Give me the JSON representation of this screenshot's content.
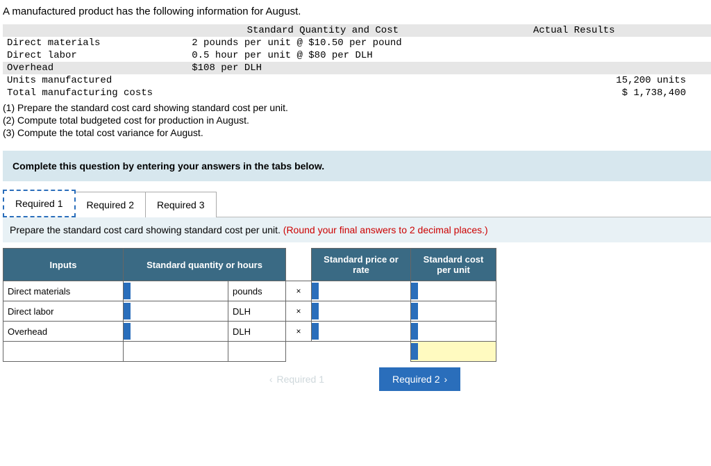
{
  "question": {
    "intro": "A manufactured product has the following information for August.",
    "table": {
      "headers": {
        "std": "Standard Quantity and Cost",
        "actual": "Actual Results"
      },
      "rows": [
        {
          "label": "Direct materials",
          "std": "2 pounds per unit @ $10.50 per pound",
          "actual": ""
        },
        {
          "label": "Direct labor",
          "std": "0.5 hour per unit @ $80 per DLH",
          "actual": ""
        },
        {
          "label": "Overhead",
          "std": "$108 per DLH",
          "actual": ""
        },
        {
          "label": "Units manufactured",
          "std": "",
          "actual": "15,200 units"
        },
        {
          "label": "Total manufacturing costs",
          "std": "",
          "actual": "$ 1,738,400"
        }
      ]
    },
    "parts": [
      "(1) Prepare the standard cost card showing standard cost per unit.",
      "(2) Compute total budgeted cost for production in August.",
      "(3) Compute the total cost variance for August."
    ]
  },
  "banner": "Complete this question by entering your answers in the tabs below.",
  "tabs": {
    "t1": "Required 1",
    "t2": "Required 2",
    "t3": "Required 3"
  },
  "tabContent": {
    "prompt": "Prepare the standard cost card showing standard cost per unit. ",
    "hint": "(Round your final answers to 2 decimal places.)"
  },
  "answerTable": {
    "headers": {
      "inputs": "Inputs",
      "sqh": "Standard quantity or hours",
      "spr": "Standard price or rate",
      "scpu": "Standard cost per unit"
    },
    "rows": [
      {
        "input": "Direct materials",
        "unit": "pounds",
        "x": "×"
      },
      {
        "input": "Direct labor",
        "unit": "DLH",
        "x": "×"
      },
      {
        "input": "Overhead",
        "unit": "DLH",
        "x": "×"
      }
    ]
  },
  "nav": {
    "prev": "Required 1",
    "next": "Required 2"
  }
}
